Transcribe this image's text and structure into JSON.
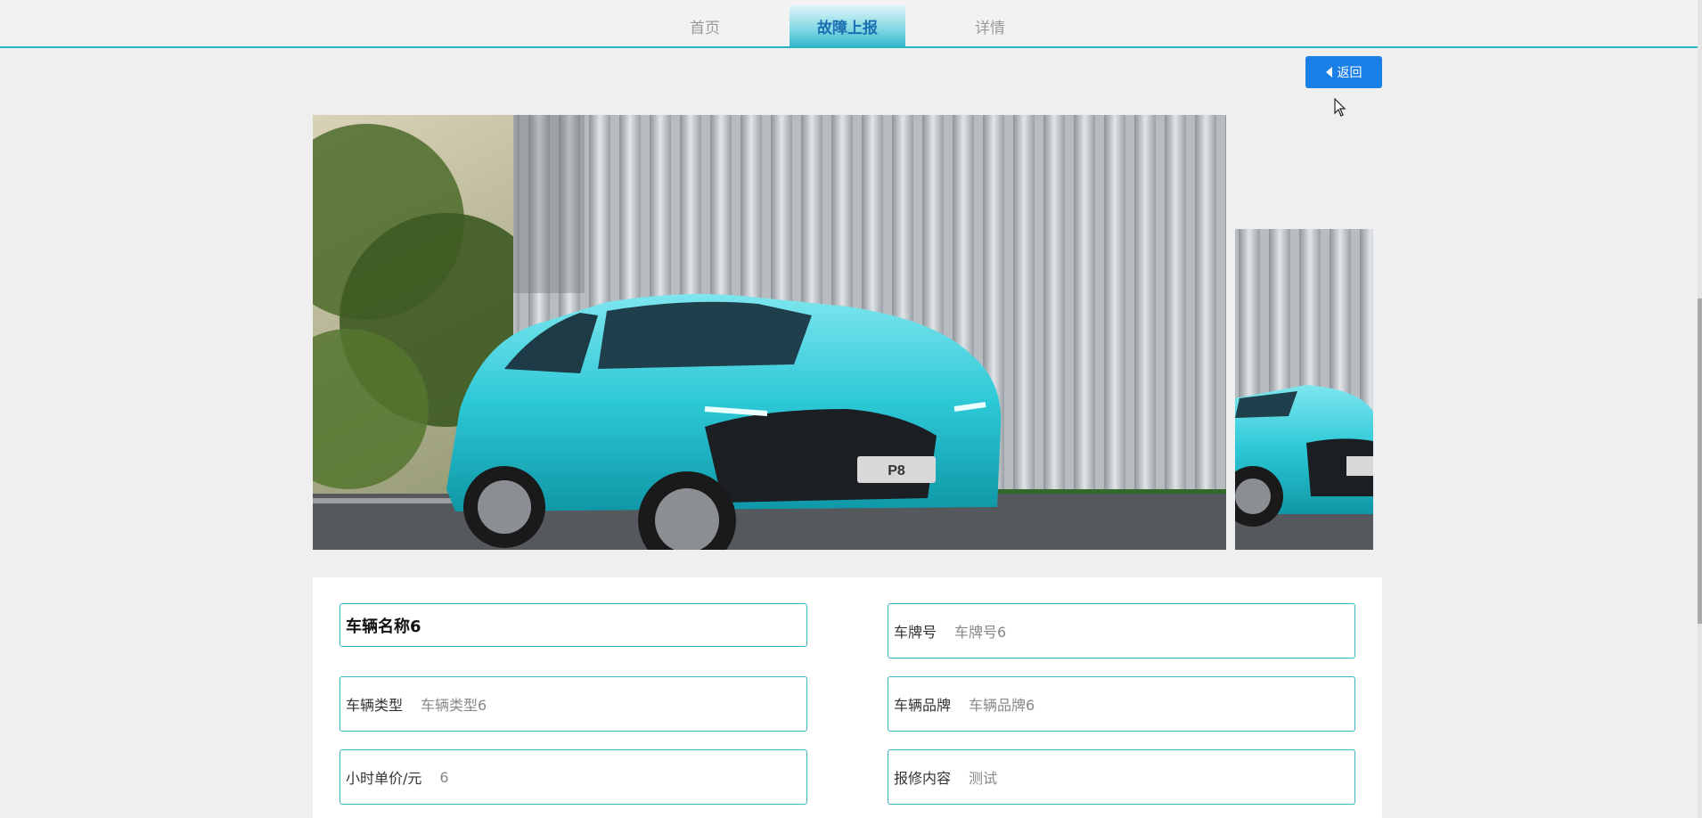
{
  "nav": {
    "tabs": [
      {
        "label": "首页",
        "active": false
      },
      {
        "label": "故障上报",
        "active": true
      },
      {
        "label": "详情",
        "active": false
      }
    ],
    "accent_color": "#2ab3c3"
  },
  "toolbar": {
    "back_label": "返回",
    "back_color": "#1a7fe6"
  },
  "vehicle_photo": {
    "plate_text": "P8"
  },
  "form": {
    "vehicle_name": "车辆名称6",
    "plate_label": "车牌号",
    "plate_value": "车牌号6",
    "type_label": "车辆类型",
    "type_value": "车辆类型6",
    "brand_label": "车辆品牌",
    "brand_value": "车辆品牌6",
    "hourly_price_label": "小时单价/元",
    "hourly_price_value": "6",
    "repair_label": "报修内容",
    "repair_value": "测试"
  }
}
